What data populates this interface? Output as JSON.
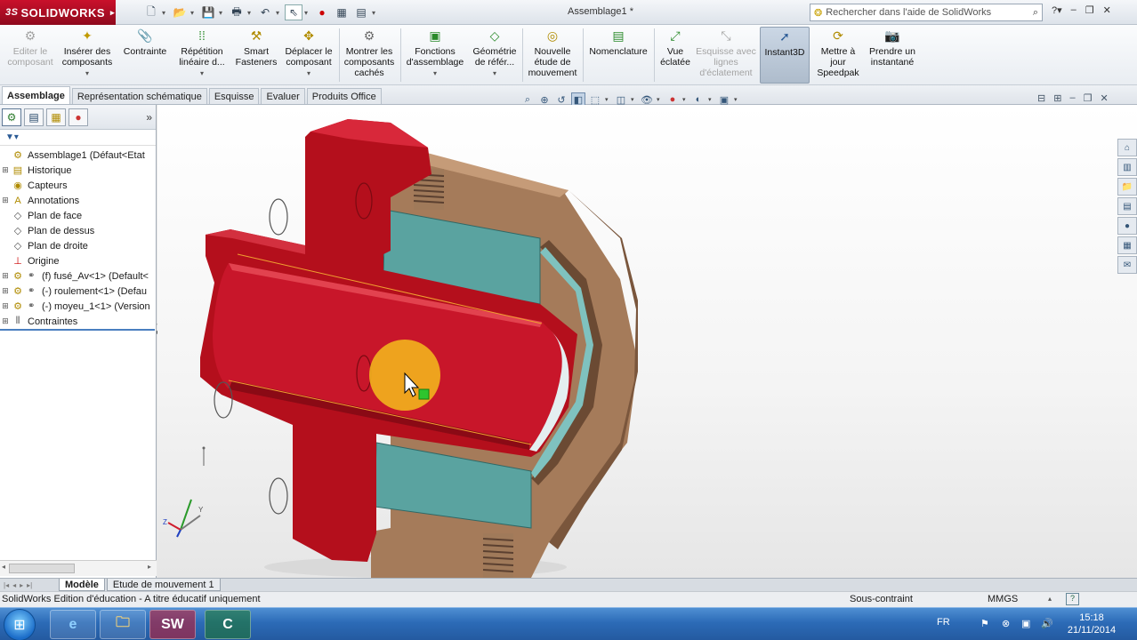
{
  "app": {
    "brand": "SOLIDWORKS",
    "brand_prefix": "3S",
    "document_title": "Assemblage1 *",
    "help_search_placeholder": "Rechercher dans l'aide de SolidWorks"
  },
  "ribbon": {
    "buttons": [
      {
        "label": "Editer le composant",
        "icon": "edit-component-icon",
        "state": "disabled"
      },
      {
        "label": "Insérer des composants",
        "icon": "insert-components-icon",
        "state": "normal"
      },
      {
        "label": "Contrainte",
        "icon": "mate-icon",
        "state": "normal"
      },
      {
        "label": "Répétition linéaire d...",
        "icon": "linear-pattern-icon",
        "state": "normal"
      },
      {
        "label": "Smart Fasteners",
        "icon": "smart-fasteners-icon",
        "state": "normal"
      },
      {
        "label": "Déplacer le composant",
        "icon": "move-component-icon",
        "state": "normal"
      },
      {
        "label": "Montrer les composants cachés",
        "icon": "show-hidden-icon",
        "state": "normal"
      },
      {
        "label": "Fonctions d'assemblage",
        "icon": "assembly-features-icon",
        "state": "normal"
      },
      {
        "label": "Géométrie de référ...",
        "icon": "reference-geometry-icon",
        "state": "normal"
      },
      {
        "label": "Nouvelle étude de mouvement",
        "icon": "motion-study-icon",
        "state": "normal"
      },
      {
        "label": "Nomenclature",
        "icon": "bom-icon",
        "state": "normal"
      },
      {
        "label": "Vue éclatée",
        "icon": "exploded-view-icon",
        "state": "normal"
      },
      {
        "label": "Esquisse avec lignes d'éclatement",
        "icon": "explode-line-sketch-icon",
        "state": "disabled"
      },
      {
        "label": "Instant3D",
        "icon": "instant3d-icon",
        "state": "active"
      },
      {
        "label": "Mettre à jour Speedpak",
        "icon": "speedpak-icon",
        "state": "normal"
      },
      {
        "label": "Prendre un instantané",
        "icon": "snapshot-icon",
        "state": "normal"
      }
    ]
  },
  "command_tabs": [
    "Assemblage",
    "Représentation schématique",
    "Esquisse",
    "Evaluer",
    "Produits Office"
  ],
  "tree": {
    "root": "Assemblage1  (Défaut<Etat",
    "items": [
      {
        "label": "Historique",
        "icon": "history-icon"
      },
      {
        "label": "Capteurs",
        "icon": "sensors-icon"
      },
      {
        "label": "Annotations",
        "icon": "annotations-icon"
      },
      {
        "label": "Plan de face",
        "icon": "plane-icon"
      },
      {
        "label": "Plan de dessus",
        "icon": "plane-icon"
      },
      {
        "label": "Plan de droite",
        "icon": "plane-icon"
      },
      {
        "label": "Origine",
        "icon": "origin-icon"
      },
      {
        "label": "(f) fusé_Av<1> (Default<",
        "icon": "part-icon"
      },
      {
        "label": "(-) roulement<1> (Defau",
        "icon": "part-icon"
      },
      {
        "label": "(-) moyeu_1<1> (Version",
        "icon": "part-icon"
      },
      {
        "label": "Contraintes",
        "icon": "mates-icon"
      }
    ]
  },
  "model_tabs": [
    "Modèle",
    "Etude de mouvement 1"
  ],
  "status": {
    "text": "SolidWorks Edition d'éducation - A titre éducatif uniquement",
    "constraint": "Sous-contraint",
    "units": "MMGS"
  },
  "taskbar": {
    "apps": [
      "ie",
      "explorer",
      "solidworks",
      "camtasia"
    ],
    "language": "FR",
    "time": "15:18",
    "date": "21/11/2014"
  },
  "colors": {
    "part_red": "#b40f1c",
    "bearing_teal": "#5aa3a0",
    "hub_brown": "#a57b5a",
    "highlight": "#f2b21d"
  }
}
